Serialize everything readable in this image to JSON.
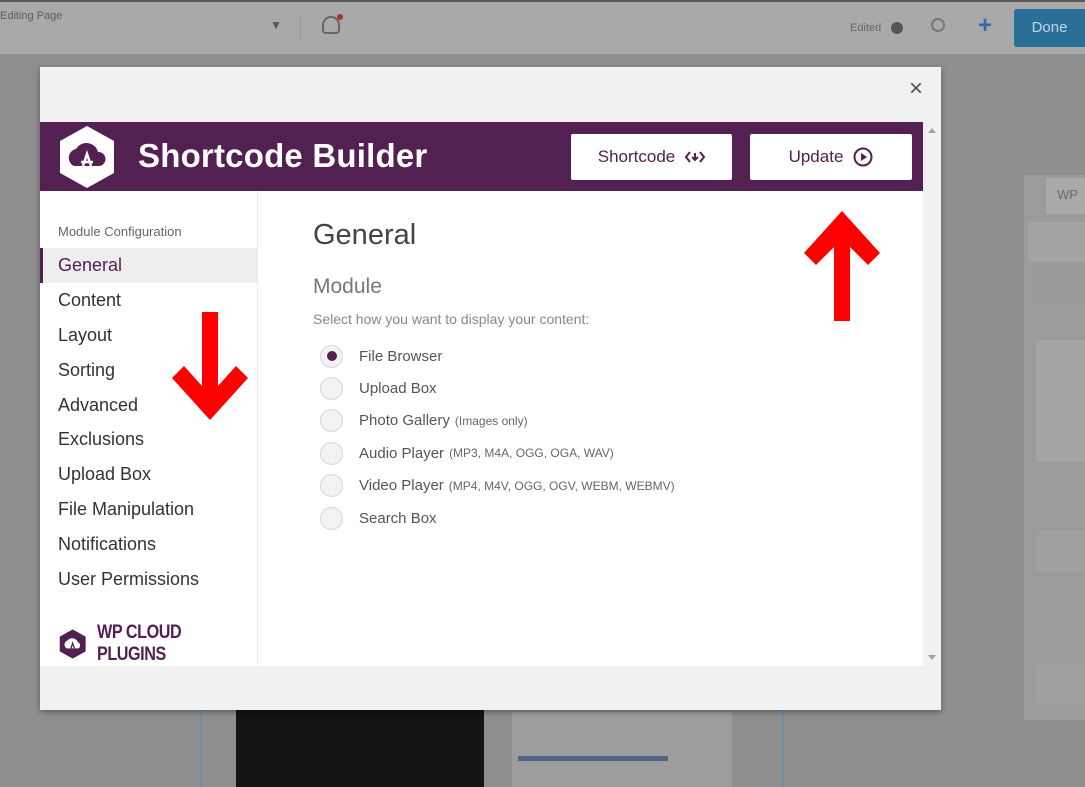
{
  "background": {
    "page_title": "Editing Page",
    "edited_label": "Edited",
    "done_label": "Done",
    "panel_tab_label": "WP"
  },
  "modal": {
    "close_glyph": "×",
    "header": {
      "title": "Shortcode Builder",
      "shortcode_button": "Shortcode",
      "update_button": "Update"
    },
    "sidebar": {
      "heading": "Module Configuration",
      "items": [
        {
          "label": "General",
          "active": true
        },
        {
          "label": "Content"
        },
        {
          "label": "Layout"
        },
        {
          "label": "Sorting"
        },
        {
          "label": "Advanced"
        },
        {
          "label": "Exclusions"
        },
        {
          "label": "Upload Box"
        },
        {
          "label": "File Manipulation"
        },
        {
          "label": "Notifications"
        },
        {
          "label": "User Permissions"
        }
      ],
      "brand": "WP CLOUD PLUGINS"
    },
    "main": {
      "title": "General",
      "module_heading": "Module",
      "module_description": "Select how you want to display your content:",
      "options": [
        {
          "label": "File Browser",
          "hint": "",
          "checked": true
        },
        {
          "label": "Upload Box",
          "hint": ""
        },
        {
          "label": "Photo Gallery",
          "hint": "(Images only)"
        },
        {
          "label": "Audio Player",
          "hint": "(MP3, M4A, OGG, OGA, WAV)"
        },
        {
          "label": "Video Player",
          "hint": "(MP4, M4V, OGG, OGV, WEBM, WEBMV)"
        },
        {
          "label": "Search Box",
          "hint": ""
        }
      ]
    }
  },
  "colors": {
    "brand_purple": "#522051",
    "annotation_red": "#ff0000"
  }
}
